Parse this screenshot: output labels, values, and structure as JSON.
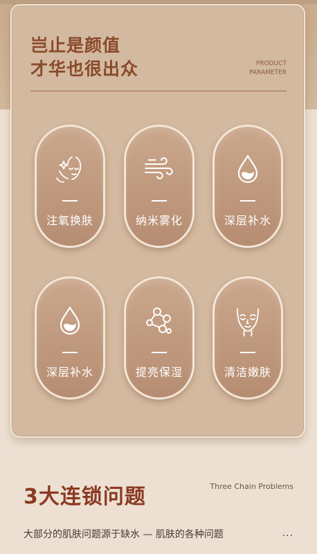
{
  "header": {
    "title_line1": "岂止是颜值",
    "title_line2": "才华也很出众",
    "tag_line1": "PRODUCT",
    "tag_line2": "PARAMETER"
  },
  "features": [
    {
      "label": "注氧换肤",
      "icon": "face-sparkle-icon"
    },
    {
      "label": "纳米雾化",
      "icon": "wind-mist-icon"
    },
    {
      "label": "深层补水",
      "icon": "water-drop-icon"
    },
    {
      "label": "深层补水",
      "icon": "water-drop-icon"
    },
    {
      "label": "提亮保湿",
      "icon": "molecule-icon"
    },
    {
      "label": "清洁嫩肤",
      "icon": "face-closed-eyes-icon"
    }
  ],
  "section": {
    "title": "3大连锁问题",
    "subtitle_en": "Three Chain Problems",
    "description": "大部分的肌肤问题源于缺水 — 肌肤的各种问题",
    "more": "..."
  },
  "colors": {
    "panel": "#d3b99f",
    "title": "#8a4a2c",
    "section_title": "#8a3a22",
    "pill": "#b68d72",
    "page_bg": "#ede0d3"
  }
}
